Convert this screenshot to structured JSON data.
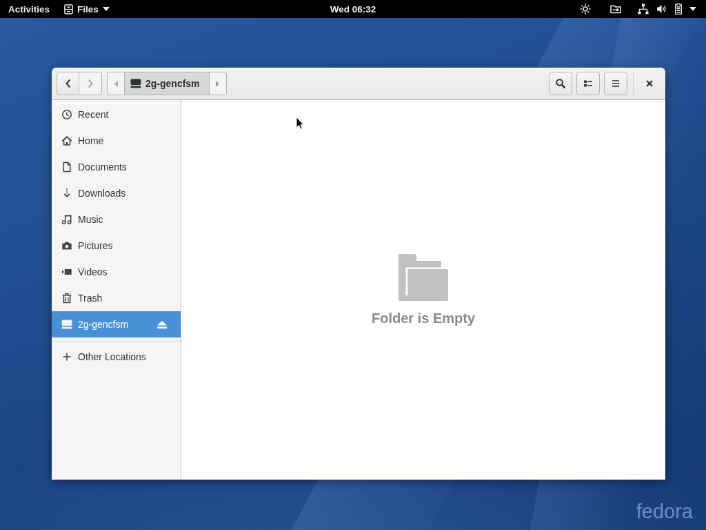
{
  "top_bar": {
    "activities": "Activities",
    "app_menu": "Files",
    "clock": "Wed 06:32"
  },
  "window": {
    "back_button": {
      "disabled": false
    },
    "forward_button": {
      "disabled": true
    },
    "path_bar": [
      {
        "label": "2g-gencfsm",
        "selected": true
      }
    ],
    "sidebar": [
      {
        "kind": "place",
        "label": "Recent",
        "selected": false
      },
      {
        "kind": "place",
        "label": "Home",
        "selected": false
      },
      {
        "kind": "place",
        "label": "Documents",
        "selected": false
      },
      {
        "kind": "place",
        "label": "Downloads",
        "selected": false
      },
      {
        "kind": "place",
        "label": "Music",
        "selected": false
      },
      {
        "kind": "place",
        "label": "Pictures",
        "selected": false
      },
      {
        "kind": "place",
        "label": "Videos",
        "selected": false
      },
      {
        "kind": "place",
        "label": "Trash",
        "selected": false
      },
      {
        "kind": "drive",
        "label": "2g-gencfsm",
        "selected": true
      },
      {
        "kind": "action",
        "label": "Other Locations",
        "selected": false
      }
    ],
    "empty_state": {
      "message": "Folder is Empty"
    }
  },
  "wallpaper_logo": "fedora"
}
